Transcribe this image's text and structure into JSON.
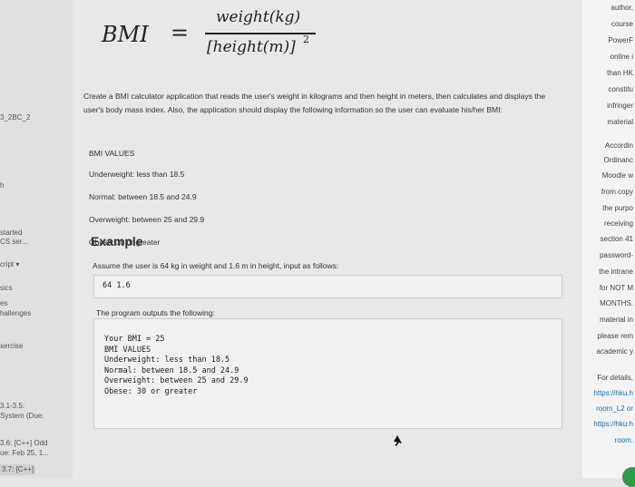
{
  "left_nav": [
    {
      "text": "3_2BC_2"
    },
    {
      "text": "h"
    },
    {
      "text": "started"
    },
    {
      "text": "CS ser..."
    },
    {
      "text": "cript"
    },
    {
      "text": "sics"
    },
    {
      "text": "es"
    },
    {
      "text": "hallenges"
    },
    {
      "text": "xercise"
    },
    {
      "text": "3.1-3.5:"
    },
    {
      "text": "System (Due:"
    },
    {
      "text": "3.6: [C++] Odd"
    },
    {
      "text": "ue: Feb 25, 1..."
    },
    {
      "text": "3.7: [C++]"
    }
  ],
  "formula": {
    "lhs": "BMI",
    "equals": "=",
    "numerator": "weight(kg)",
    "denominator": "[height(m)]",
    "exponent": "2"
  },
  "description": "Create a BMI calculator application that reads the user's weight in kilograms and then height in meters, then calculates and displays the user's body mass index. Also, the application should display the following information so the user can evaluate his/her BMI:",
  "bmi_values": {
    "heading": "BMI VALUES",
    "items": [
      "Underweight: less than 18.5",
      "Normal: between 18.5 and 24.9",
      "Overweight: between 25 and 29.9",
      "Obese: 30 or greater"
    ]
  },
  "example": {
    "heading": "Example",
    "assumption": "Assume the user is 64 kg in weight and 1.6 m in height, input as follows:",
    "input": "64 1.6",
    "output_intro": "The program outputs the following:",
    "output_lines": [
      "Your BMI = 25",
      "BMI VALUES",
      "Underweight: less than 18.5",
      "Normal: between 18.5 and 24.9",
      "Overweight: between 25 and 29.9",
      "Obese: 30 or greater"
    ]
  },
  "right_notice": [
    {
      "text": "author,"
    },
    {
      "text": "course"
    },
    {
      "text": "PowerF"
    },
    {
      "text": "online i"
    },
    {
      "text": "than HK"
    },
    {
      "text": "constitu"
    },
    {
      "text": "infringer"
    },
    {
      "text": "material"
    },
    {
      "text": "Accordin"
    },
    {
      "text": "Ordinanc"
    },
    {
      "text": "Moodle w"
    },
    {
      "text": "from copy"
    },
    {
      "text": "the purpo"
    },
    {
      "text": "receiving"
    },
    {
      "text": "section 41"
    },
    {
      "text": "password-"
    },
    {
      "text": "the intrane"
    },
    {
      "text": "for NOT M"
    },
    {
      "text": "MONTHS."
    },
    {
      "text": "material in"
    },
    {
      "text": "please rem"
    },
    {
      "text": "academic y"
    },
    {
      "text": "For details,"
    },
    {
      "text": "https://hku.h"
    },
    {
      "text": "room_L2 or"
    },
    {
      "text": "https://hku.h"
    },
    {
      "text": "room."
    }
  ],
  "colors": {
    "accent_green": "#2e9b47",
    "link_blue": "#1a6fb0",
    "code_box_bg": "#f1f1f1"
  }
}
